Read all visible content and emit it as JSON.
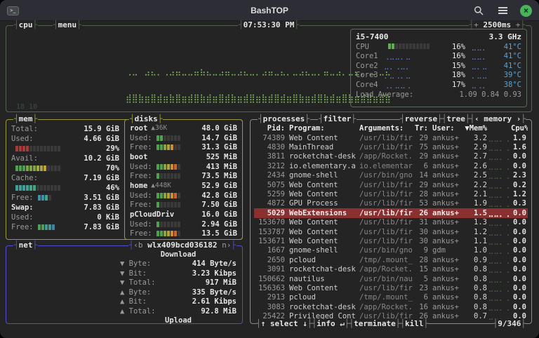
{
  "window": {
    "title": "BashTOP"
  },
  "colors": {
    "bg": "#242424",
    "titlebar": "#2d2d35",
    "fg": "#e6e6e6",
    "label": "#9a9a9a",
    "border_cpu": "#53644e",
    "border_mem": "#9c9840",
    "border_net": "#5050cf",
    "border_proc": "#8a8a8a",
    "graph_green": "#83bd5e",
    "core_graph": "#5b79d1",
    "temp": "#62a0d0",
    "meter_off": "#3a3a3a",
    "sel_bg": "#8b3030",
    "close_green": "#47b559"
  },
  "palettes": {
    "red": [
      "#a83a3a",
      "#bb4a3a",
      "#cc5a3a",
      "#d46a3a"
    ],
    "avail": [
      "#4fa04f",
      "#7aa83f",
      "#a3a838",
      "#c6a031",
      "#cf8a2e"
    ],
    "cache": [
      "#3f9f9b",
      "#45a57f",
      "#57aa5a",
      "#86ae43"
    ],
    "free": [
      "#3f93a8",
      "#44a291"
    ],
    "swapfree": [
      "#4fa05a",
      "#44988f",
      "#4083a8"
    ],
    "disk": [
      "#4fa04f",
      "#8aa83a",
      "#b3a333",
      "#cc8f30",
      "#cc6530",
      "#c94030"
    ],
    "cpu": [
      "#5fae4f",
      "#78b53f"
    ]
  },
  "cpu": {
    "title": "cpu",
    "menu_label": "menu",
    "clock": "07:53:30 PM",
    "int_left": "+",
    "int_value": "2500ms",
    "int_right": "+",
    "model": "i5-7400",
    "freq": "3.3 GHz",
    "graph1": "⢀⣀⠀⣠⣄⡀⢀⣠⣤⣀⣀⣤⣦⣄⣀⣠⣤⣀⣠⣄⣀⡀⣠⣤⣀⣄⡀⣀⣠⣄⣀⡀⣤⣀⣠⡀⣀⣄⡀⢀⡀⣀⣄",
    "graph2": "⣾⣿⣷⣶⣿⣾⣶⣷⣿⣶⣾⣿⣷⣾⣶⣿⣾⣷⣶⣾⣿⣶⣷⣾⣿⣾⣶⣿⣷⣶⣾⣿⣷⣾⣶⣿⣷⣶⣾⣿⣶⣾⣷",
    "uptime": "18 10",
    "rows": [
      {
        "name": "CPU",
        "meter": {
          "pct": 16,
          "pal": "cpu",
          "n": 12
        },
        "pct": "16%",
        "temp_graph": "⣀⣀⡀",
        "temp": "41°C"
      },
      {
        "name": "Core1",
        "graph": "⢀⣀⣀⡀⣀",
        "pct": "16%",
        "temp_graph": "⣀⣀⡀",
        "temp": "41°C"
      },
      {
        "name": "Core2",
        "graph": "⣀⡀⢀⣀⡀",
        "pct": "15%",
        "temp_graph": "⣀⡀⣀",
        "temp": "41°C"
      },
      {
        "name": "Core3",
        "graph": "⡀⣀⢀⡀⣀",
        "pct": "18%",
        "temp_graph": "⡀⣀⣀",
        "temp": "39°C"
      },
      {
        "name": "Core4",
        "graph": "⢀⡀⣀⣀⢀",
        "pct": "17%",
        "temp_graph": "⣀⢀⡀",
        "temp": "38°C"
      }
    ],
    "load_label": "Load Average:",
    "load_values": "1.09   0.84   0.93"
  },
  "mem": {
    "title": "mem",
    "lines": [
      {
        "l": "Total:",
        "v": "15.9 GiB"
      },
      {
        "l": "Used:",
        "v": "4.66 GiB"
      },
      {
        "m": {
          "pct": 29,
          "pal": "red",
          "n": 13
        },
        "p": "29%"
      },
      {
        "l": "Avail:",
        "v": "10.2 GiB"
      },
      {
        "m": {
          "pct": 70,
          "pal": "avail",
          "n": 13
        },
        "p": "70%"
      },
      {
        "l": "Cache:",
        "v": "7.19 GiB"
      },
      {
        "m": {
          "pct": 46,
          "pal": "cache",
          "n": 13
        },
        "p": "46%"
      },
      {
        "l": "Free:",
        "m": {
          "pct": 70,
          "pal": "free",
          "n": 4
        },
        "v": "3.51 GiB"
      },
      {
        "l": "Swap:",
        "lb": 1,
        "v": "7.83 GiB"
      },
      {
        "l": "Used:",
        "v": "0 KiB"
      },
      {
        "l": "Free:",
        "m": {
          "pct": 100,
          "pal": "swapfree",
          "n": 5
        },
        "v": "7.83 GiB"
      }
    ]
  },
  "disks": {
    "title": "disks",
    "lines": [
      {
        "l": "root",
        "lb": 1,
        "io": "▲36K",
        "v": "48.0 GiB"
      },
      {
        "l": "Used:",
        "m": {
          "pct": 31,
          "pal": "disk",
          "n": 7
        },
        "v": "14.7 GiB"
      },
      {
        "l": "Free:",
        "m": {
          "pct": 65,
          "pal": "disk",
          "n": 7
        },
        "v": "31.3 GiB"
      },
      {
        "l": "boot",
        "lb": 1,
        "v": "525 MiB"
      },
      {
        "l": "Used:",
        "m": {
          "pct": 79,
          "pal": "disk",
          "n": 7
        },
        "v": "413 MiB"
      },
      {
        "l": "Free:",
        "m": {
          "pct": 14,
          "pal": "disk",
          "n": 7
        },
        "v": "73.5 MiB"
      },
      {
        "l": "home",
        "lb": 1,
        "io": "▲448K",
        "v": "52.9 GiB"
      },
      {
        "l": "Used:",
        "m": {
          "pct": 85,
          "pal": "disk",
          "n": 7
        },
        "v": "42.8 GiB"
      },
      {
        "l": "Free:",
        "m": {
          "pct": 14,
          "pal": "disk",
          "n": 7
        },
        "v": "7.50 GiB"
      },
      {
        "l": "pCloudDriv",
        "lb": 1,
        "v": "16.0 GiB"
      },
      {
        "l": "Used:",
        "m": {
          "pct": 18,
          "pal": "disk",
          "n": 7
        },
        "v": "2.94 GiB"
      },
      {
        "l": "Free:",
        "m": {
          "pct": 84,
          "pal": "disk",
          "n": 7
        },
        "v": "13.5 GiB"
      }
    ]
  },
  "net": {
    "title": "net",
    "iface_prev": "‹b",
    "iface": "wlx409bcd036182",
    "iface_next": "n›",
    "lines": [
      {
        "header": "Download"
      },
      {
        "l": "▼ Byte:",
        "v": "414 Byte/s"
      },
      {
        "l": "▼ Bit:",
        "v": "3.23 Kibps"
      },
      {
        "l": "▼ Total:",
        "v": "917 MiB"
      },
      {
        "l": "▲ Byte:",
        "v": "335 Byte/s"
      },
      {
        "l": "▲ Bit:",
        "v": "2.61 Kibps"
      },
      {
        "l": "▲ Total:",
        "v": "92.8 MiB"
      },
      {
        "header": "Upload"
      }
    ]
  },
  "processes": {
    "title": "processes",
    "filter_label": "filter",
    "controls": {
      "reverse": "reverse",
      "tree": "tree",
      "sort_prev": "‹",
      "sort_field": "memory",
      "sort_next": "›"
    },
    "headers": {
      "pid": "Pid:",
      "program": "Program:",
      "args": "Arguments:",
      "threads": "Tr:",
      "user": "User:",
      "mem": "▼Mem%",
      "cpu": "Cpu%"
    },
    "row_graph": "⣀⣀⡀⢀",
    "rows": [
      {
        "pid": "74389",
        "program": "Web Content",
        "args": "/usr/lib/fir",
        "threads": "29",
        "user": "ankus+",
        "mem": "3.2",
        "cpu": "1.9"
      },
      {
        "pid": "4830",
        "program": "MainThread",
        "args": "/usr/lib/fir",
        "threads": "75",
        "user": "ankus+",
        "mem": "2.9",
        "cpu": "1.6"
      },
      {
        "pid": "3811",
        "program": "rocketchat-desk",
        "args": "/app/Rocket.",
        "threads": "29",
        "user": "ankus+",
        "mem": "2.7",
        "cpu": "0.0"
      },
      {
        "pid": "3212",
        "program": "io.elementary.a",
        "args": "io.elementar",
        "threads": "6",
        "user": "ankus+",
        "mem": "2.6",
        "cpu": "0.0"
      },
      {
        "pid": "2434",
        "program": "gnome-shell",
        "args": "/usr/bin/gno",
        "threads": "14",
        "user": "ankus+",
        "mem": "2.5",
        "cpu": "2.3"
      },
      {
        "pid": "5075",
        "program": "Web Content",
        "args": "/usr/lib/fir",
        "threads": "29",
        "user": "ankus+",
        "mem": "2.2",
        "cpu": "0.2"
      },
      {
        "pid": "5259",
        "program": "Web Content",
        "args": "/usr/lib/fir",
        "threads": "28",
        "user": "ankus+",
        "mem": "2.1",
        "cpu": "1.2"
      },
      {
        "pid": "4872",
        "program": "GPU Process",
        "args": "/usr/lib/fir",
        "threads": "53",
        "user": "ankus+",
        "mem": "1.9",
        "cpu": "0.3"
      },
      {
        "pid": "5029",
        "program": "WebExtensions",
        "args": "/usr/lib/fir",
        "threads": "26",
        "user": "ankus+",
        "mem": "1.5",
        "cpu": "0.0",
        "selected": true
      },
      {
        "pid": "153670",
        "program": "Web Content",
        "args": "/usr/lib/fir",
        "threads": "31",
        "user": "ankus+",
        "mem": "1.3",
        "cpu": "0.0"
      },
      {
        "pid": "153787",
        "program": "Web Content",
        "args": "/usr/lib/fir",
        "threads": "30",
        "user": "ankus+",
        "mem": "1.2",
        "cpu": "0.0"
      },
      {
        "pid": "153671",
        "program": "Web Content",
        "args": "/usr/lib/fir",
        "threads": "30",
        "user": "ankus+",
        "mem": "1.1",
        "cpu": "0.0"
      },
      {
        "pid": "1667",
        "program": "gnome-shell",
        "args": "/usr/bin/gno",
        "threads": "9",
        "user": "gdm",
        "mem": "1.0",
        "cpu": "0.0"
      },
      {
        "pid": "2650",
        "program": "pcloud",
        "args": "/tmp/.mount_",
        "threads": "28",
        "user": "ankus+",
        "mem": "0.9",
        "cpu": "0.0"
      },
      {
        "pid": "3091",
        "program": "rocketchat-desk",
        "args": "/app/Rocket.",
        "threads": "15",
        "user": "ankus+",
        "mem": "0.8",
        "cpu": "0.0"
      },
      {
        "pid": "150662",
        "program": "nautilus",
        "args": "/usr/bin/nau",
        "threads": "5",
        "user": "ankus+",
        "mem": "0.8",
        "cpu": "0.0"
      },
      {
        "pid": "156363",
        "program": "Web Content",
        "args": "/usr/lib/fir",
        "threads": "23",
        "user": "ankus+",
        "mem": "0.8",
        "cpu": "0.0"
      },
      {
        "pid": "2913",
        "program": "pcloud",
        "args": "/tmp/.mount_",
        "threads": "6",
        "user": "ankus+",
        "mem": "0.8",
        "cpu": "0.0"
      },
      {
        "pid": "3083",
        "program": "rocketchat-desk",
        "args": "/app/Rocket.",
        "threads": "16",
        "user": "ankus+",
        "mem": "0.8",
        "cpu": "0.0"
      },
      {
        "pid": "25422",
        "program": "Privileged Cont",
        "args": "/usr/lib/fir",
        "threads": "26",
        "user": "ankus+",
        "mem": "0.7",
        "cpu": "0.0"
      }
    ],
    "footer": {
      "select": "↑ select ↓",
      "info": "info ↵",
      "terminate": "terminate",
      "kill": "kill",
      "count": "9/346"
    }
  }
}
